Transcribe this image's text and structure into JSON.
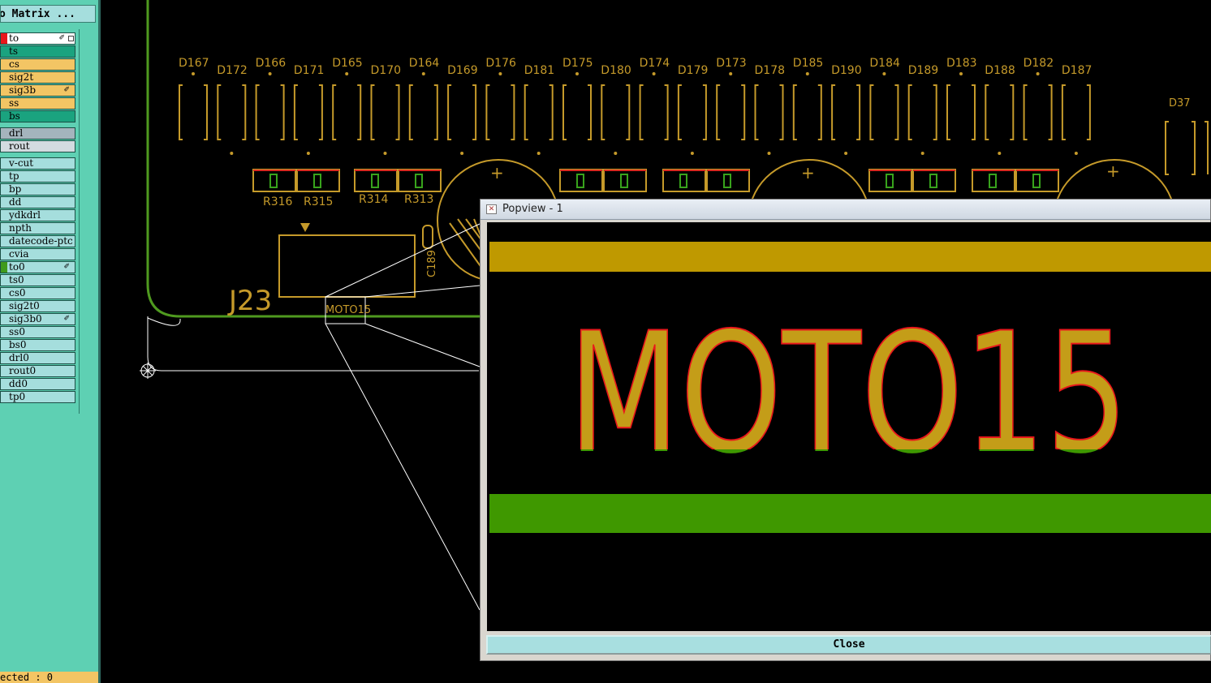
{
  "panel": {
    "title": "o Matrix ...",
    "layers": [
      {
        "name": "to",
        "color": "#ffffff",
        "swatch": "#e8171b",
        "edit": true,
        "marker": true
      },
      {
        "name": "ts",
        "color": "#1aa37f",
        "swatch": "",
        "edit": false
      },
      {
        "name": "cs",
        "color": "#f3c564",
        "swatch": "",
        "edit": false
      },
      {
        "name": "sig2t",
        "color": "#f3c564",
        "swatch": "",
        "edit": false
      },
      {
        "name": "sig3b",
        "color": "#f3c564",
        "swatch": "",
        "edit": true
      },
      {
        "name": "ss",
        "color": "#f3c564",
        "swatch": "",
        "edit": false
      },
      {
        "name": "bs",
        "color": "#1aa37f",
        "swatch": "",
        "edit": false
      },
      {
        "name": "drl",
        "color": "#a4b4bd",
        "swatch": "",
        "edit": false
      },
      {
        "name": "rout",
        "color": "#d3dbe0",
        "swatch": "",
        "edit": false
      },
      {
        "name": "v-cut",
        "color": "#a5dedd",
        "swatch": "",
        "edit": false
      },
      {
        "name": "tp",
        "color": "#a5dedd",
        "swatch": "",
        "edit": false
      },
      {
        "name": "bp",
        "color": "#a5dedd",
        "swatch": "",
        "edit": false
      },
      {
        "name": "dd",
        "color": "#a5dedd",
        "swatch": "",
        "edit": false
      },
      {
        "name": "ydkdrl",
        "color": "#a5dedd",
        "swatch": "",
        "edit": false
      },
      {
        "name": "npth",
        "color": "#a5dedd",
        "swatch": "",
        "edit": false
      },
      {
        "name": "datecode-ptc",
        "color": "#a5dedd",
        "swatch": "",
        "edit": false
      },
      {
        "name": "cvia",
        "color": "#a5dedd",
        "swatch": "",
        "edit": false
      },
      {
        "name": "to0",
        "color": "#a5dedd",
        "swatch": "#3f9b1c",
        "edit": true
      },
      {
        "name": "ts0",
        "color": "#a5dedd",
        "swatch": "",
        "edit": false
      },
      {
        "name": "cs0",
        "color": "#a5dedd",
        "swatch": "",
        "edit": false
      },
      {
        "name": "sig2t0",
        "color": "#a5dedd",
        "swatch": "",
        "edit": false
      },
      {
        "name": "sig3b0",
        "color": "#a5dedd",
        "swatch": "",
        "edit": true
      },
      {
        "name": "ss0",
        "color": "#a5dedd",
        "swatch": "",
        "edit": false
      },
      {
        "name": "bs0",
        "color": "#a5dedd",
        "swatch": "",
        "edit": false
      },
      {
        "name": "drl0",
        "color": "#a5dedd",
        "swatch": "",
        "edit": false
      },
      {
        "name": "rout0",
        "color": "#a5dedd",
        "swatch": "",
        "edit": false
      },
      {
        "name": "dd0",
        "color": "#a5dedd",
        "swatch": "",
        "edit": false
      },
      {
        "name": "tp0",
        "color": "#a5dedd",
        "swatch": "",
        "edit": false
      }
    ],
    "edit_glyph": "✐",
    "status": "ected : 0"
  },
  "canvas": {
    "colors": {
      "silk": "#c59a2a",
      "board_edge": "#4f9a1f",
      "pad_red": "#d8281e",
      "pad_green": "#38a31c",
      "outline": "#ffffff"
    },
    "diodes_top": [
      {
        "label": "D167"
      },
      {
        "label": "D172"
      },
      {
        "label": "D166"
      },
      {
        "label": "D171"
      },
      {
        "label": "D165"
      },
      {
        "label": "D170"
      },
      {
        "label": "D164"
      },
      {
        "label": "D169"
      },
      {
        "label": "D176"
      },
      {
        "label": "D181"
      },
      {
        "label": "D175"
      },
      {
        "label": "D180"
      },
      {
        "label": "D174"
      },
      {
        "label": "D179"
      },
      {
        "label": "D173"
      },
      {
        "label": "D178"
      },
      {
        "label": "D185"
      },
      {
        "label": "D190"
      },
      {
        "label": "D184"
      },
      {
        "label": "D189"
      },
      {
        "label": "D183"
      },
      {
        "label": "D188"
      },
      {
        "label": "D182"
      },
      {
        "label": "D187"
      }
    ],
    "d37": "D37",
    "resistors": [
      "R316",
      "R315",
      "R314",
      "R313"
    ],
    "connector_label": "J23",
    "cap_label": "C189",
    "moto_small": "MOTO15",
    "plus": "+"
  },
  "popview": {
    "title": "Popview - 1",
    "text": "MOTO15",
    "close_label": "Close",
    "colors": {
      "top_band": "#bf9900",
      "bottom_band": "#3f9800",
      "text_fill": "#c49d18",
      "text_outline": "#e8171b",
      "text_lower": "#3f9800"
    }
  }
}
